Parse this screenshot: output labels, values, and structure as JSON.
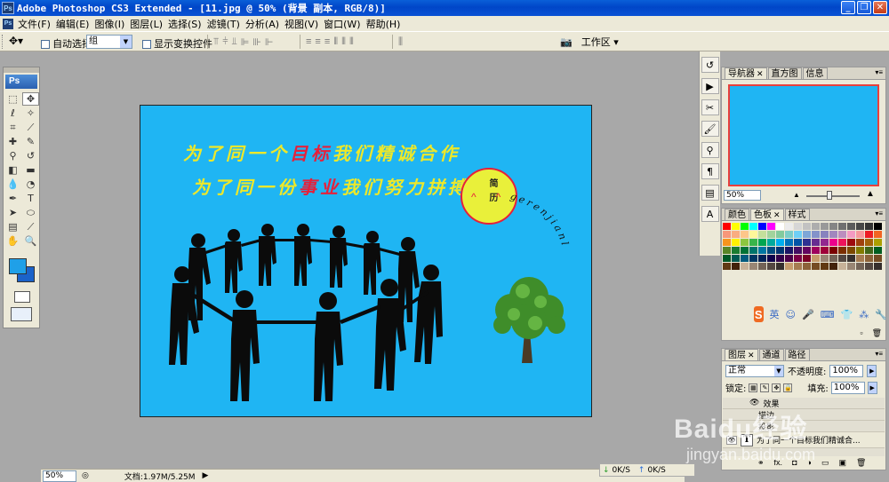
{
  "window": {
    "title": "Adobe Photoshop CS3 Extended - [11.jpg @ 50% (背景 副本, RGB/8)]"
  },
  "menu": [
    "文件(F)",
    "编辑(E)",
    "图像(I)",
    "图层(L)",
    "选择(S)",
    "滤镜(T)",
    "分析(A)",
    "视图(V)",
    "窗口(W)",
    "帮助(H)"
  ],
  "options": {
    "auto_select_label": "自动选择:",
    "group_value": "组",
    "show_transform_label": "显示变换控件",
    "workspace_label": "工作区 ▾"
  },
  "toolbox": {
    "logo": "Ps",
    "fg_color": "#1fa0e8",
    "bg_color": "#1b62c9"
  },
  "canvas": {
    "line1_a": "为了同一个",
    "line1_b": "目标",
    "line1_c": "我们精诚合作",
    "line2_a": "为了同一份",
    "line2_b": "事业",
    "line2_c": "我们努力拼搏",
    "badge_text": "简历",
    "arc_text": "gerenjianl",
    "bg_color": "#1fb5f3"
  },
  "status": {
    "zoom": "50%",
    "doc_info": "文档:1.97M/5.25M"
  },
  "navigator": {
    "tabs": [
      "导航器",
      "直方图",
      "信息"
    ],
    "zoom": "50%"
  },
  "swatches_panel": {
    "tabs": [
      "颜色",
      "色板",
      "样式"
    ],
    "ime_label": "英"
  },
  "layers_panel": {
    "tabs": [
      "图层",
      "通道",
      "路径"
    ],
    "blend_mode": "正常",
    "opacity_label": "不透明度:",
    "opacity_value": "100%",
    "lock_label": "锁定:",
    "fill_label": "填充:",
    "fill_value": "100%",
    "layers": [
      "效果",
      "描边",
      "投影",
      "为了同一个目标我们精诚合..."
    ],
    "footer_icons": [
      "fx.",
      "◘",
      "◑",
      "▭",
      "▣",
      "🗑"
    ]
  },
  "netbar": {
    "down": "0K/S",
    "up": "0K/S"
  },
  "watermark": {
    "logo": "Baidu经验",
    "sub": "jingyan.baidu.com"
  }
}
